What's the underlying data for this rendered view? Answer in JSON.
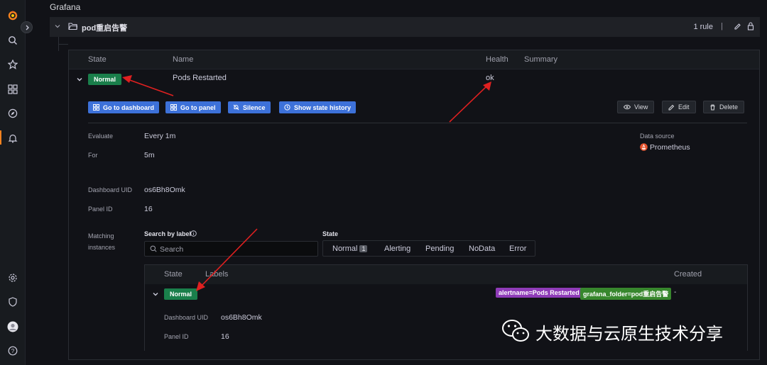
{
  "app": {
    "title": "Grafana"
  },
  "folder": {
    "name": "pod重启告警",
    "rule_count": "1 rule",
    "separator": "|"
  },
  "table": {
    "headers": {
      "state": "State",
      "name": "Name",
      "health": "Health",
      "summary": "Summary"
    },
    "rule": {
      "state": "Normal",
      "name": "Pods Restarted",
      "health": "ok",
      "summary": ""
    }
  },
  "actions": {
    "go_dashboard": "Go to dashboard",
    "go_panel": "Go to panel",
    "silence": "Silence",
    "history": "Show state history",
    "view": "View",
    "edit": "Edit",
    "delete": "Delete"
  },
  "details": {
    "evaluate_label": "Evaluate",
    "evaluate_value": "Every 1m",
    "for_label": "For",
    "for_value": "5m",
    "dashboard_uid_label": "Dashboard UID",
    "dashboard_uid_value": "os6Bh8Omk",
    "panel_id_label": "Panel ID",
    "panel_id_value": "16",
    "datasource_label": "Data source",
    "datasource_value": "Prometheus",
    "matching_label_1": "Matching",
    "matching_label_2": "instances"
  },
  "filters": {
    "search_label": "Search by label",
    "search_placeholder": "Search",
    "state_label": "State",
    "states": [
      "Normal",
      "Alerting",
      "Pending",
      "NoData",
      "Error"
    ],
    "normal_count": "1"
  },
  "instances": {
    "headers": {
      "state": "State",
      "labels": "Labels",
      "created": "Created"
    },
    "row": {
      "state": "Normal",
      "labels": [
        "alertname=Pods Restarted",
        "grafana_folder=pod重启告警"
      ],
      "created": "-",
      "dashboard_uid_label": "Dashboard UID",
      "dashboard_uid_value": "os6Bh8Omk",
      "panel_id_label": "Panel ID",
      "panel_id_value": "16"
    }
  },
  "colors": {
    "accent": "#3d71d9",
    "normal": "#1a7f4b",
    "tag_purple": "#8f3bb8",
    "tag_green": "#37872d",
    "arrow": "#e02020"
  },
  "watermark": {
    "text": "大数据与云原生技术分享"
  }
}
